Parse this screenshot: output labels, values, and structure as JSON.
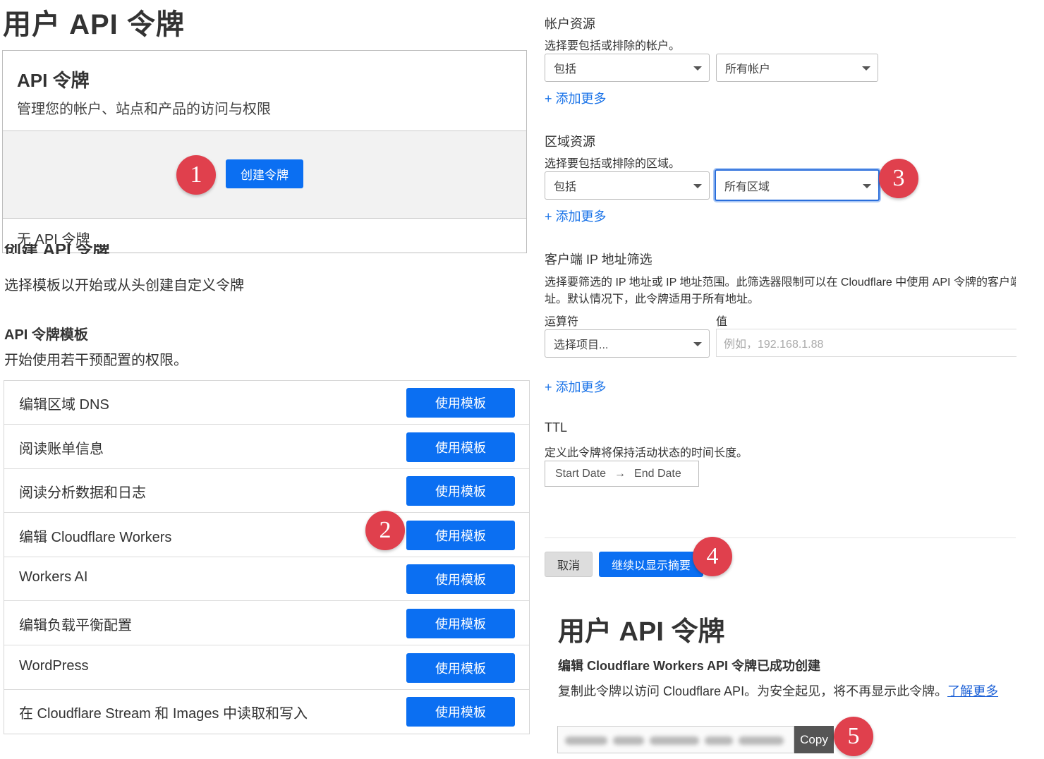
{
  "page_title": "用户 API 令牌",
  "card": {
    "title": "API 令牌",
    "subtitle": "管理您的帐户、站点和产品的访问与权限",
    "create_button": "创建令牌",
    "empty_text": "无 API 令牌"
  },
  "create_section": {
    "title": "创建 API 令牌",
    "subtitle": "选择模板以开始或从头创建自定义令牌"
  },
  "templates_section": {
    "title": "API 令牌模板",
    "subtitle": "开始使用若干预配置的权限。",
    "button_label": "使用模板",
    "items": [
      "编辑区域 DNS",
      "阅读账单信息",
      "阅读分析数据和日志",
      "编辑 Cloudflare Workers",
      "Workers AI",
      "编辑负载平衡配置",
      "WordPress",
      "在 Cloudflare Stream 和 Images 中读取和写入"
    ]
  },
  "account_resources": {
    "title": "帐户资源",
    "subtitle": "选择要包括或排除的帐户。",
    "include_value": "包括",
    "scope_value": "所有帐户",
    "add_more": "添加更多"
  },
  "zone_resources": {
    "title": "区域资源",
    "subtitle": "选择要包括或排除的区域。",
    "include_value": "包括",
    "scope_value": "所有区域",
    "add_more": "添加更多"
  },
  "ip_filter": {
    "title": "客户端 IP 地址筛选",
    "description_line1": "选择要筛选的 IP 地址或 IP 地址范围。此筛选器限制可以在 Cloudflare 中使用 API 令牌的客户端",
    "description_line2": "址。默认情况下，此令牌适用于所有地址。",
    "operator_label": "运算符",
    "value_label": "值",
    "operator_placeholder": "选择项目...",
    "value_placeholder": "例如，192.168.1.88",
    "add_more": "添加更多"
  },
  "ttl": {
    "title": "TTL",
    "subtitle": "定义此令牌将保持活动状态的时间长度。",
    "start_date": "Start Date",
    "end_date": "End Date"
  },
  "actions": {
    "cancel": "取消",
    "continue": "继续以显示摘要"
  },
  "result": {
    "title": "用户 API 令牌",
    "success": "编辑 Cloudflare Workers API 令牌已成功创建",
    "message": "复制此令牌以访问 Cloudflare API。为安全起见，将不再显示此令牌。",
    "learn_more": "了解更多",
    "copy_button": "Copy"
  },
  "step_badges": [
    "1",
    "2",
    "3",
    "4",
    "5"
  ],
  "colors": {
    "primary": "#0b6ff2",
    "badge": "#e0404d",
    "link": "#1a73e8"
  }
}
